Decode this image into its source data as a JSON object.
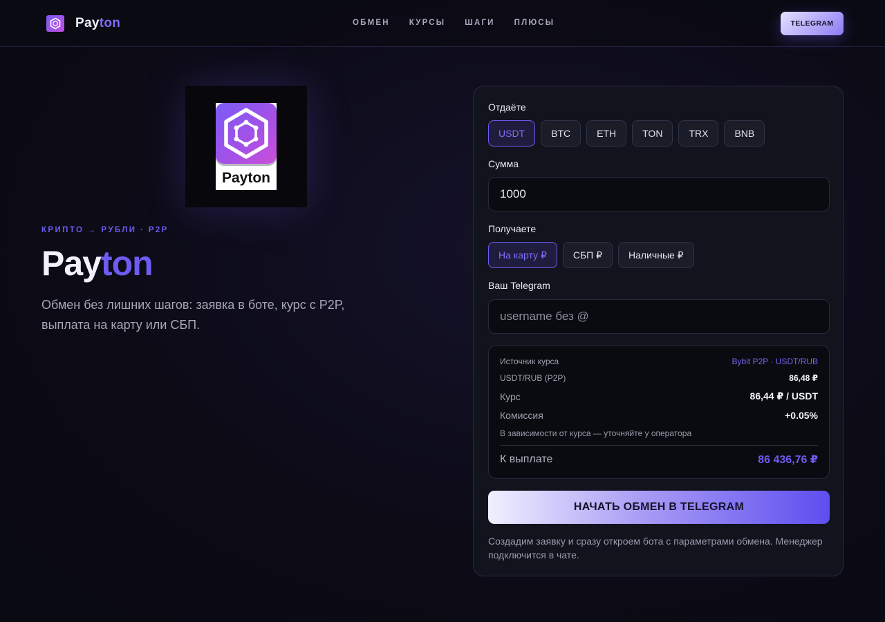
{
  "header": {
    "brand_a": "Pay",
    "brand_b": "ton",
    "nav": [
      "ОБМЕН",
      "КУРСЫ",
      "ШАГИ",
      "ПЛЮСЫ"
    ],
    "telegram_button": "TELEGRAM"
  },
  "hero": {
    "image_label": "Payton",
    "eyebrow": "КРИПТО → РУБЛИ · P2P",
    "title_a": "Pay",
    "title_b": "ton",
    "subtitle": "Обмен без лишних шагов: заявка в боте, курс с P2P, выплата на карту или СБП."
  },
  "exchange": {
    "give_label": "Отдаёте",
    "give_options": [
      "USDT",
      "BTC",
      "ETH",
      "TON",
      "TRX",
      "BNB"
    ],
    "give_selected": "USDT",
    "amount_label": "Сумма",
    "amount_value": "1000",
    "receive_label": "Получаете",
    "receive_options": [
      "На карту ₽",
      "СБП ₽",
      "Наличные ₽"
    ],
    "receive_selected": "На карту ₽",
    "telegram_label": "Ваш Telegram",
    "telegram_placeholder": "username без @",
    "summary": {
      "source_key": "Источник курса",
      "source_val": "Bybit P2P · USDT/RUB",
      "pair_key": "USDT/RUB (P2P)",
      "pair_val": "86,48 ₽",
      "rate_key": "Курс",
      "rate_val": "86,44 ₽ / USDT",
      "fee_key": "Комиссия",
      "fee_val": "+0.05%",
      "note": "В зависимости от курса — уточняйте у оператора",
      "payout_key": "К выплате",
      "payout_val": "86 436,76 ₽"
    },
    "cta": "НАЧАТЬ ОБМЕН В TELEGRAM",
    "footnote": "Создадим заявку и сразу откроем бота с параметрами обмена. Менеджер подключится в чате."
  },
  "colors": {
    "accent": "#6c5cf2",
    "background": "#0c0b16",
    "panel": "#11131d"
  },
  "icons": {
    "logo": "hexagon-logo-icon"
  }
}
